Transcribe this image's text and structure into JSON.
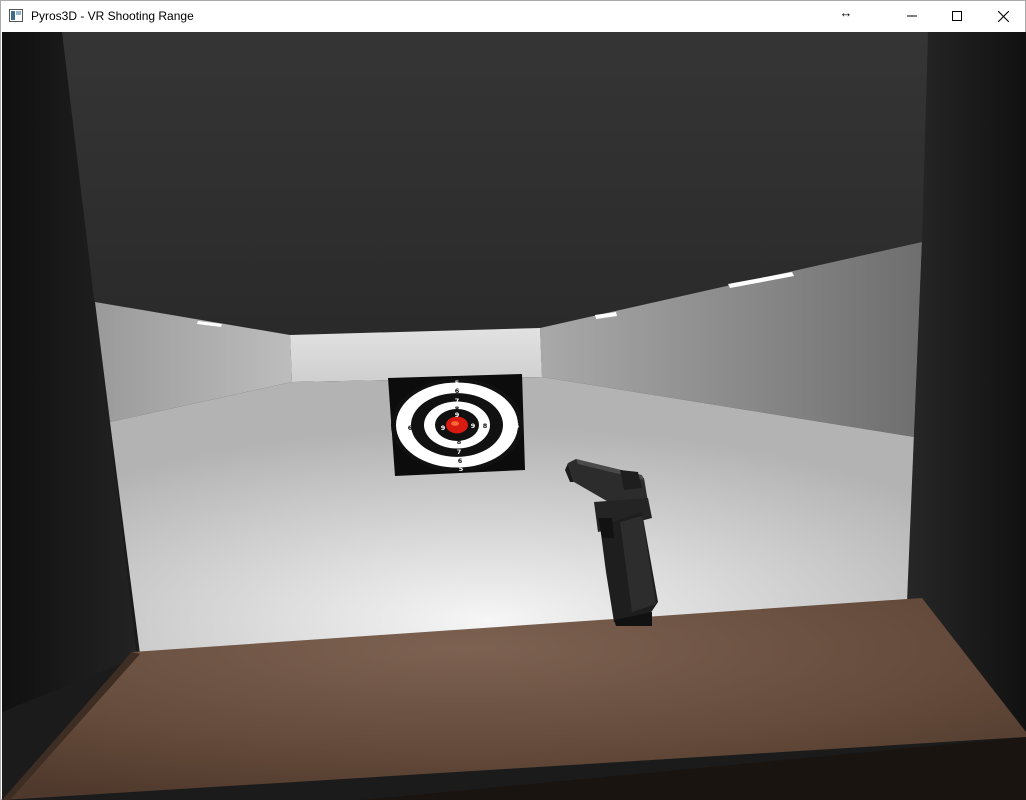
{
  "window": {
    "title": "Pyros3D - VR Shooting Range",
    "controls": {
      "resize": "resize-arrows-icon",
      "minimize": "minimize-icon",
      "maximize": "maximize-icon",
      "close": "close-icon"
    }
  },
  "scene": {
    "target": {
      "labels": {
        "top": [
          "5",
          "6",
          "7",
          "8",
          "9"
        ],
        "bottom": [
          "8",
          "7",
          "6",
          "5"
        ],
        "left": [
          "5",
          "6",
          "7",
          "8",
          "9"
        ],
        "right": [
          "9",
          "8",
          "7",
          "6",
          "5"
        ]
      }
    },
    "colors": {
      "ceiling": "#2f2f2f",
      "back_wall": "#d9d9d9",
      "side_wall": "#8c8c8c",
      "floor": "#cfcfcf",
      "pillar": "#141414",
      "counter": "#6a5040",
      "bullseye": "#d81b10"
    }
  }
}
